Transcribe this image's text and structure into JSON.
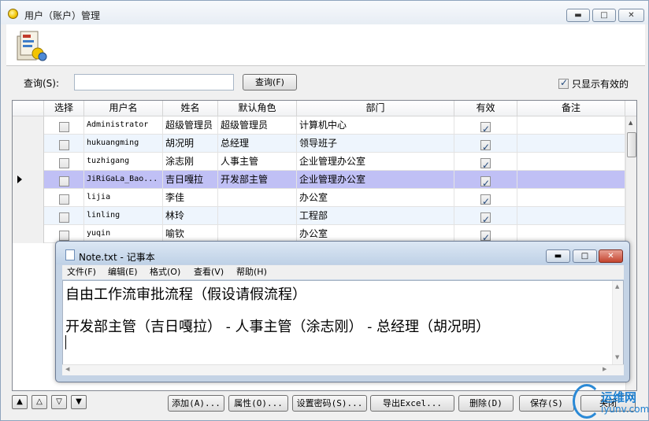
{
  "window": {
    "title": "用户（账户）管理",
    "min_glyph": "▬",
    "max_glyph": "□",
    "close_glyph": "✕"
  },
  "search": {
    "label": "查询(S):",
    "value": "",
    "button": "查询(F)"
  },
  "filter": {
    "only_valid_label": "只显示有效的",
    "only_valid_checked": true
  },
  "grid": {
    "columns": [
      "选择",
      "用户名",
      "姓名",
      "默认角色",
      "部门",
      "有效",
      "备注"
    ],
    "rows": [
      {
        "username": "Administrator",
        "name": "超级管理员",
        "role": "超级管理员",
        "dept": "计算机中心",
        "valid": true,
        "note": ""
      },
      {
        "username": "hukuangming",
        "name": "胡况明",
        "role": "总经理",
        "dept": "领导班子",
        "valid": true,
        "note": ""
      },
      {
        "username": "tuzhigang",
        "name": "涂志刚",
        "role": "人事主管",
        "dept": "企业管理办公室",
        "valid": true,
        "note": ""
      },
      {
        "username": "JiRiGaLa_Bao...",
        "name": "吉日嘎拉",
        "role": "开发部主管",
        "dept": "企业管理办公室",
        "valid": true,
        "note": ""
      },
      {
        "username": "lijia",
        "name": "李佳",
        "role": "",
        "dept": "办公室",
        "valid": true,
        "note": ""
      },
      {
        "username": "linling",
        "name": "林玲",
        "role": "",
        "dept": "工程部",
        "valid": true,
        "note": ""
      },
      {
        "username": "yuqin",
        "name": "喻钦",
        "role": "",
        "dept": "办公室",
        "valid": true,
        "note": ""
      }
    ],
    "selected_index": 3
  },
  "notepad": {
    "title": "Note.txt - 记事本",
    "menu": [
      "文件(F)",
      "编辑(E)",
      "格式(O)",
      "查看(V)",
      "帮助(H)"
    ],
    "lines": [
      "自由工作流审批流程（假设请假流程）",
      "开发部主管（吉日嘎拉） - 人事主管（涂志刚） - 总经理（胡况明）"
    ]
  },
  "nav": {
    "first": "▲",
    "prev": "△",
    "next": "▽",
    "last": "▼"
  },
  "buttons": {
    "add": "添加(A)...",
    "properties": "属性(O)...",
    "set_password": "设置密码(S)...",
    "export_excel": "导出Excel...",
    "delete": "删除(D)",
    "save": "保存(S)",
    "close": "关闭"
  },
  "watermark": {
    "line1": "运维网",
    "line2": "iyunv.com"
  }
}
